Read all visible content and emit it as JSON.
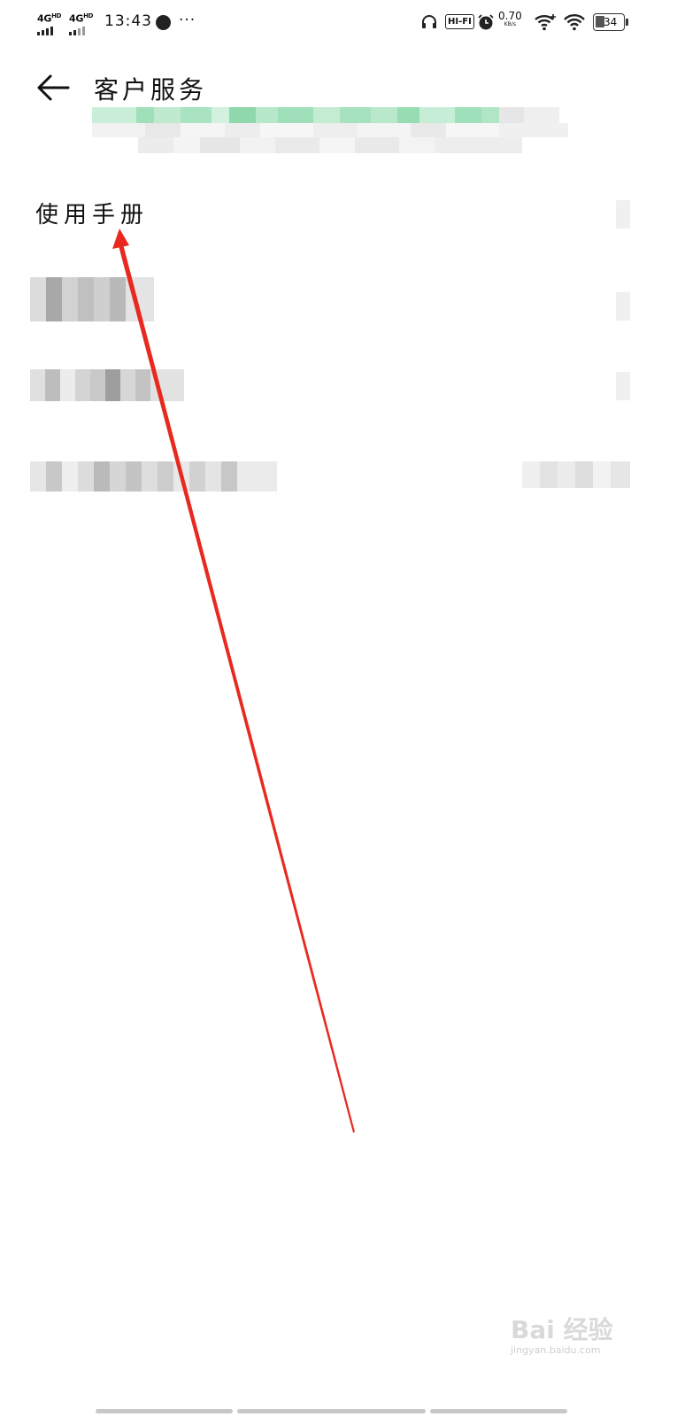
{
  "status_bar": {
    "sim1": "4G",
    "sim1_sup": "HD",
    "sim2": "4G",
    "sim2_sup": "HD",
    "time": "13:43",
    "more": "···",
    "hifi": "HI-FI",
    "net_speed": "0.70",
    "net_unit": "KB/s",
    "battery": "34"
  },
  "header": {
    "back_icon": "arrow-left-icon",
    "title": "客户服务"
  },
  "list": {
    "manual_label": "使用手册"
  },
  "watermark": {
    "brand": "Bai 经验",
    "url": "jingyan.baidu.com"
  },
  "colors": {
    "arrow": "#e8291f",
    "banner_green": "#7fd6a6"
  }
}
